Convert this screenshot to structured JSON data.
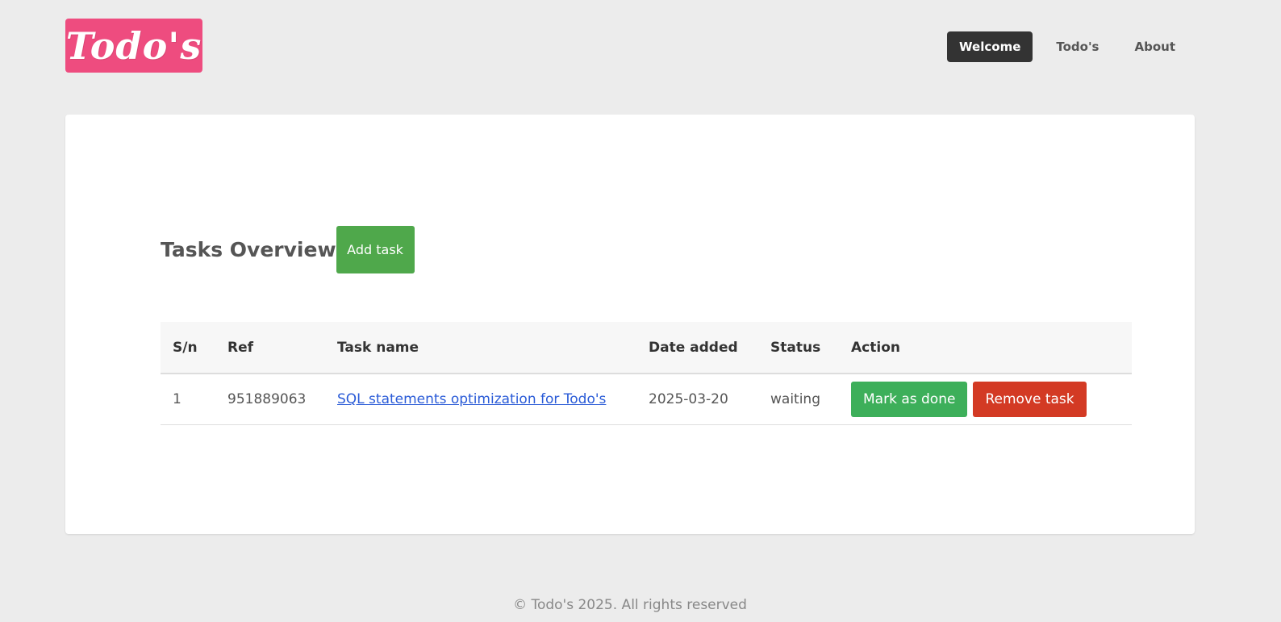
{
  "logo": {
    "text": "Todo's"
  },
  "nav": {
    "items": [
      {
        "label": "Welcome",
        "active": true
      },
      {
        "label": "Todo's",
        "active": false
      },
      {
        "label": "About",
        "active": false
      }
    ]
  },
  "main": {
    "title": "Tasks Overview",
    "add_task_label": "Add task",
    "table": {
      "headers": [
        "S/n",
        "Ref",
        "Task name",
        "Date added",
        "Status",
        "Action"
      ],
      "rows": [
        {
          "sn": "1",
          "ref": "951889063",
          "task_name": "SQL statements optimization for Todo's",
          "date_added": "2025-03-20",
          "status": "waiting",
          "mark_done_label": "Mark as done",
          "remove_label": "Remove task"
        }
      ]
    }
  },
  "footer": {
    "text": "© Todo's 2025. All rights reserved"
  },
  "colors": {
    "logo_bg": "#ee4c7f",
    "nav_active_bg": "#333333",
    "add_button": "#4fa84b",
    "mark_done_button": "#3daf5a",
    "remove_button": "#d33a24",
    "link": "#2a5bd7"
  }
}
